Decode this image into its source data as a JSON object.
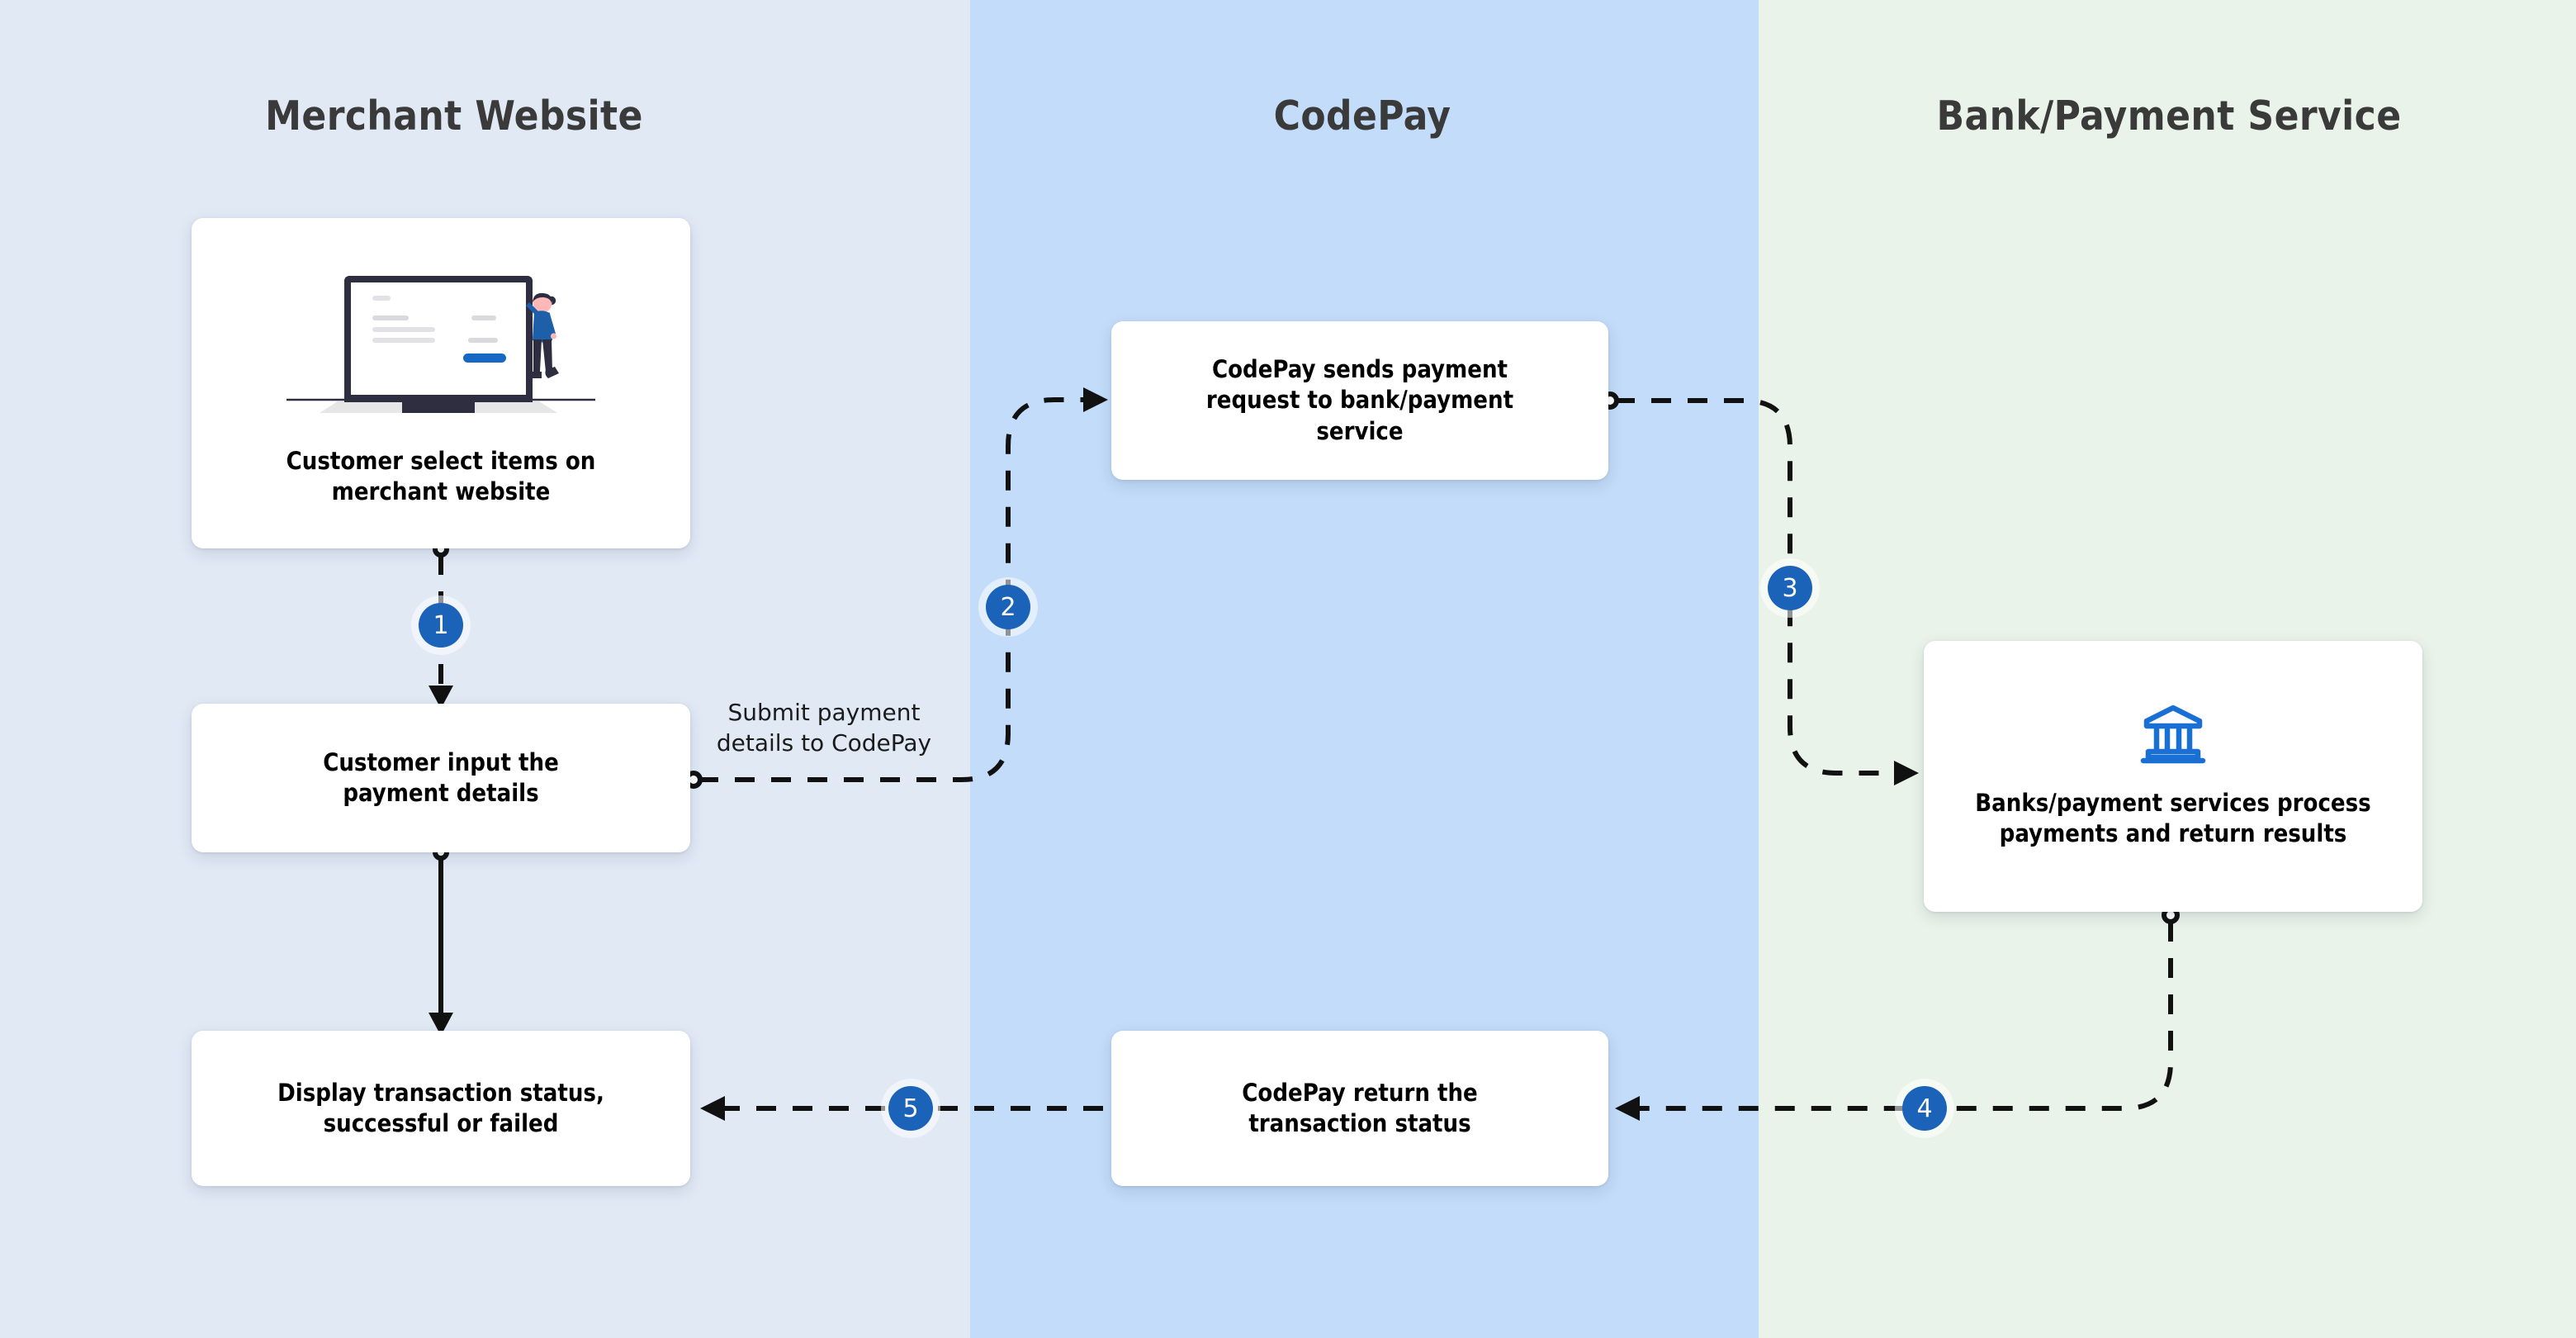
{
  "lanes": [
    {
      "id": "merchant",
      "title": "Merchant Website",
      "bg": "#e1e9f5"
    },
    {
      "id": "codepay",
      "title": "CodePay",
      "bg": "#c2dcf9"
    },
    {
      "id": "bank",
      "title": "Bank/Payment Service",
      "bg": "#e9f3e9"
    }
  ],
  "nodes": {
    "select": {
      "text": "Customer select items on\nmerchant website",
      "icon": "laptop-shopping-illustration",
      "lane": "merchant"
    },
    "input": {
      "text": "Customer input the\npayment details",
      "lane": "merchant"
    },
    "status": {
      "text": "Display transaction status,\nsuccessful or failed",
      "lane": "merchant"
    },
    "send": {
      "text": "CodePay sends payment\nrequest to bank/payment\nservice",
      "lane": "codepay"
    },
    "return": {
      "text": "CodePay return the\ntransaction status",
      "lane": "codepay"
    },
    "bank": {
      "text": "Banks/payment services process\npayments and return results",
      "icon": "bank-icon",
      "lane": "bank"
    }
  },
  "edges": [
    {
      "step": "1",
      "from": "select",
      "to": "input",
      "style": "dashed",
      "label": ""
    },
    {
      "step": "2",
      "from": "input",
      "to": "send",
      "style": "dashed",
      "label": "Submit payment\ndetails to CodePay"
    },
    {
      "step": "3",
      "from": "send",
      "to": "bank",
      "style": "dashed",
      "label": ""
    },
    {
      "step": "4",
      "from": "bank",
      "to": "return",
      "style": "dashed",
      "label": ""
    },
    {
      "step": "5",
      "from": "return",
      "to": "status",
      "style": "dashed",
      "label": ""
    },
    {
      "step": "",
      "from": "input",
      "to": "status",
      "style": "solid",
      "label": ""
    }
  ],
  "labels": {
    "submit": "Submit payment\ndetails to CodePay"
  },
  "colors": {
    "badge": "#1a63b8",
    "bank_icon": "#1a6fd4",
    "connector": "#111111",
    "card": "#ffffff",
    "title_text": "#3a3a3a"
  }
}
